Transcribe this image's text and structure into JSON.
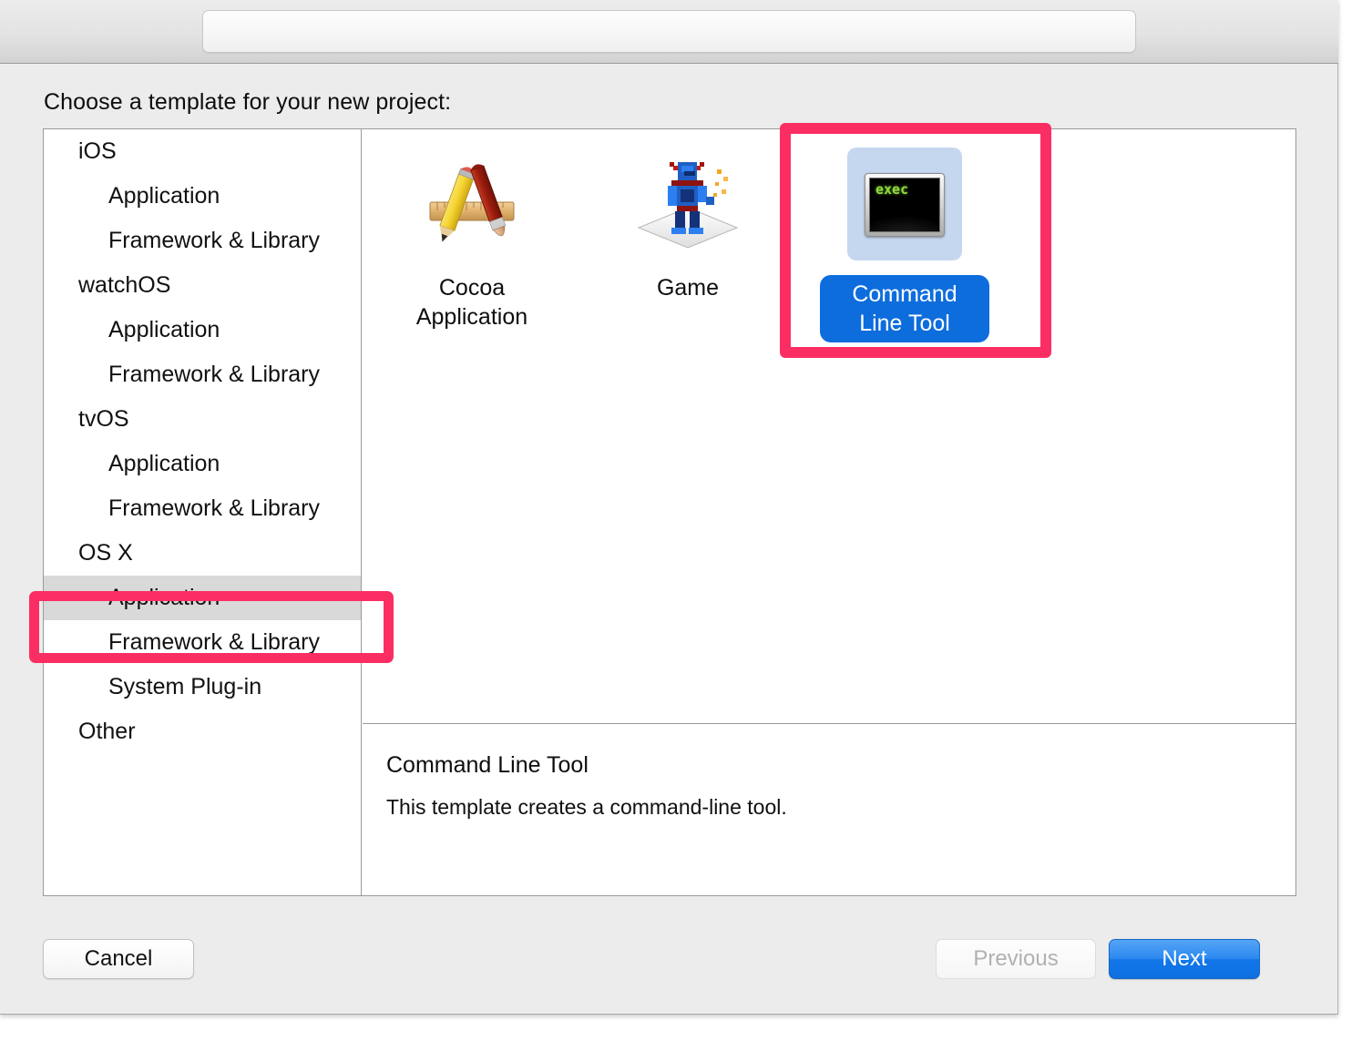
{
  "window": {
    "toolbar": {
      "field_value": "",
      "field_placeholder": ""
    }
  },
  "sheet": {
    "prompt": "Choose a template for your new project:"
  },
  "sidebar": {
    "items": [
      {
        "label": "iOS",
        "level": "group",
        "selected": false
      },
      {
        "label": "Application",
        "level": "child",
        "selected": false
      },
      {
        "label": "Framework & Library",
        "level": "child",
        "selected": false
      },
      {
        "label": "watchOS",
        "level": "group",
        "selected": false
      },
      {
        "label": "Application",
        "level": "child",
        "selected": false
      },
      {
        "label": "Framework & Library",
        "level": "child",
        "selected": false
      },
      {
        "label": "tvOS",
        "level": "group",
        "selected": false
      },
      {
        "label": "Application",
        "level": "child",
        "selected": false
      },
      {
        "label": "Framework & Library",
        "level": "child",
        "selected": false
      },
      {
        "label": "OS X",
        "level": "group",
        "selected": false
      },
      {
        "label": "Application",
        "level": "child",
        "selected": true
      },
      {
        "label": "Framework & Library",
        "level": "child",
        "selected": false
      },
      {
        "label": "System Plug-in",
        "level": "child",
        "selected": false
      },
      {
        "label": "Other",
        "level": "group",
        "selected": false
      }
    ]
  },
  "templates": [
    {
      "label": "Cocoa Application",
      "icon": "cocoa-ruler-pencil-brush-icon",
      "selected": false
    },
    {
      "label": "Game",
      "icon": "game-robot-icon",
      "selected": false
    },
    {
      "label": "Command Line Tool",
      "icon": "terminal-exec-icon",
      "selected": true,
      "screen_text": "exec"
    }
  ],
  "description": {
    "title": "Command Line Tool",
    "body": "This template creates a command-line tool."
  },
  "footer": {
    "cancel": "Cancel",
    "previous": "Previous",
    "next": "Next"
  },
  "annotations": {
    "color": "#fb2e63",
    "sidebar_target": "Application",
    "tile_target": "Command Line Tool"
  }
}
